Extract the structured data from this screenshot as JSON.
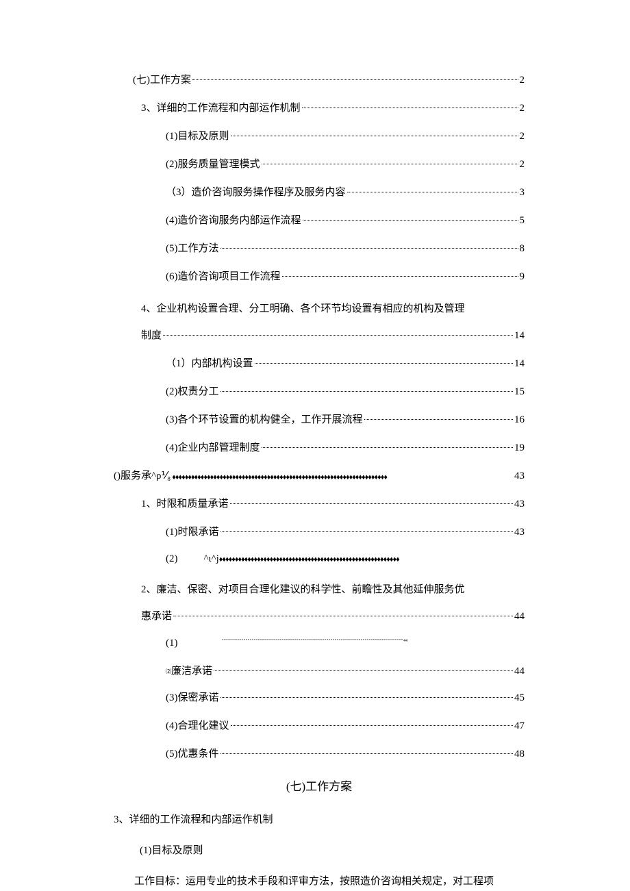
{
  "toc": {
    "l0_1": {
      "label": "(七)工作方案",
      "page": "2"
    },
    "l1_1": {
      "label": "3、详细的工作流程和内部运作机制",
      "page": "2"
    },
    "l2_1": {
      "label": "(1)目标及原则",
      "page": "2"
    },
    "l2_2": {
      "label": "(2)服务质量管理模式",
      "page": "2"
    },
    "l2_3": {
      "label": "（3）造价咨询服务操作程序及服务内容",
      "page": "3"
    },
    "l2_4": {
      "label": "(4)造价咨询服务内部运作流程",
      "page": "5"
    },
    "l2_5": {
      "label": "(5)工作方法",
      "page": "8"
    },
    "l2_6": {
      "label": "(6)造价咨询项目工作流程",
      "page": "9"
    },
    "l1_2a": {
      "label": "4、企业机构设置合理、分工明确、各个环节均设置有相应的机构及管理"
    },
    "l1_2b": {
      "label": "制度",
      "page": "14"
    },
    "l2_7": {
      "label": "（1）内部机构设置",
      "page": "14"
    },
    "l2_8": {
      "label": "(2)权责分工",
      "page": "15"
    },
    "l2_9": {
      "label": "(3)各个环节设置的机构健全，工作开展流程",
      "page": "16"
    },
    "l2_10": {
      "label": "(4)企业内部管理制度",
      "page": "19"
    },
    "l0_2": {
      "label": "()服务承^ρ⅟₈",
      "page": "43",
      "fill": "♦♦♦♦♦♦♦♦♦♦♦♦♦♦♦♦♦♦♦♦♦♦♦♦♦♦♦♦♦♦♦♦♦♦♦♦♦♦♦♦♦♦♦♦♦♦♦♦♦♦♦♦♦♦♦♦♦♦♦♦♦♦♦♦♦♦♦♦"
    },
    "l1_3": {
      "label": "1、时限和质量承诺",
      "page": "43"
    },
    "l2_11": {
      "label": "(1)时限承诺",
      "page": "43"
    },
    "l2_12": {
      "num": "(2)",
      "mid": "^ι^j",
      "fill": "♦♦♦♦♦♦♦♦♦♦♦♦♦♦♦♦♦♦♦♦♦♦♦♦♦♦♦♦♦♦♦♦♦♦♦♦♦♦♦♦♦♦♦♦♦♦♦♦♦♦♦♦♦♦♦♦♦"
    },
    "l1_4a": {
      "label": "2、廉洁、保密、对项目合理化建议的科学性、前瞻性及其他延伸服务优"
    },
    "l1_4b": {
      "label": "惠承诺",
      "page": "44"
    },
    "l2_13": {
      "num": "(1)",
      "dots": "\"\"\"\"\"\"\"\"\"\"\"\"\"\"\"\"\"\"\"\"\"\"\"\"\"\"\"\"\"\"\"\"\"\"\"\"\"\"\"\"\"\"\"\"\"\"\"\"\"\"\"\"\"\"\"\"\"\"\"\"\"\"\"\"\"\"\"\"\"\"\"\"\"\"\"\"\"\"\"\"\"\"\"\"\"\"\"\"\"\"",
      "page": "44"
    },
    "l2_14": {
      "sub": "⑵",
      "label": "廉洁承诺",
      "page": "44"
    },
    "l2_15": {
      "label": "(3)保密承诺",
      "page": "45"
    },
    "l2_16": {
      "label": "(4)合理化建议",
      "page": "47"
    },
    "l2_17": {
      "label": "(5)优惠条件",
      "page": "48"
    }
  },
  "body": {
    "heading": "(七)工作方案",
    "h2": "3、详细的工作流程和内部运作机制",
    "h3": "(1)目标及原则",
    "para": "工作目标：运用专业的技术手段和评审方法，按照造价咨询相关规定，对工程项"
  }
}
